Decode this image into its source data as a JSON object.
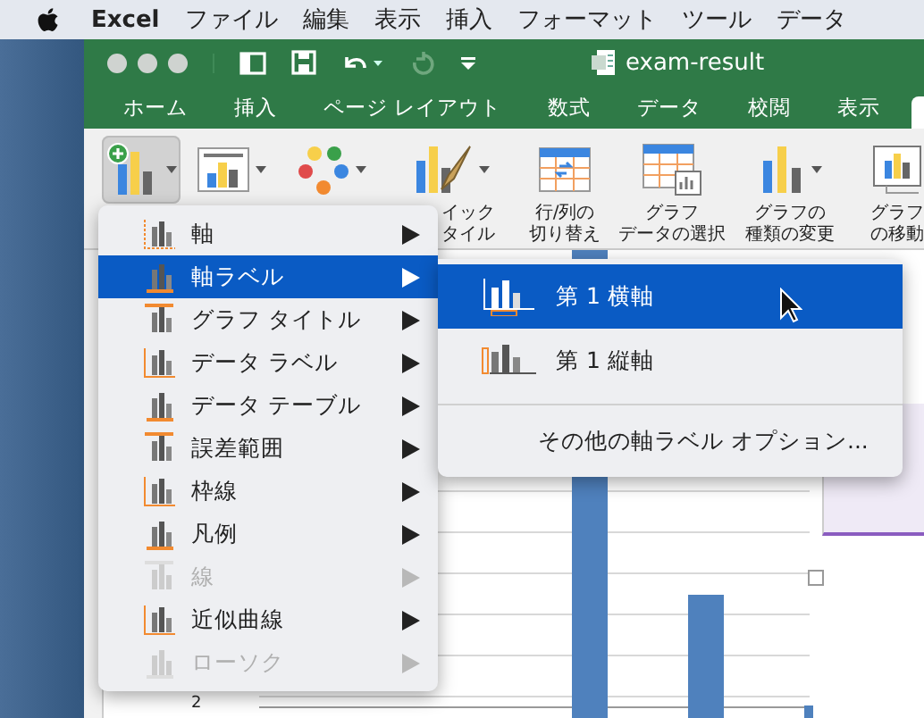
{
  "menubar": {
    "app": "Excel",
    "items": [
      "ファイル",
      "編集",
      "表示",
      "挿入",
      "フォーマット",
      "ツール",
      "データ"
    ]
  },
  "window": {
    "title": "exam-result"
  },
  "tabs": [
    {
      "label": "ホーム"
    },
    {
      "label": "挿入"
    },
    {
      "label": "ページ レイアウト"
    },
    {
      "label": "数式"
    },
    {
      "label": "データ"
    },
    {
      "label": "校閲"
    },
    {
      "label": "表示"
    }
  ],
  "ribbon": {
    "buttons": [
      {
        "kind": "add-element",
        "pressed": true,
        "dropdown": true
      },
      {
        "kind": "quick-layout",
        "pressed": false,
        "dropdown": true
      },
      {
        "kind": "colors",
        "pressed": false,
        "dropdown": true
      },
      {
        "kind": "styles",
        "pressed": false,
        "dropdown": true,
        "lines": [
          "イック",
          "タイル"
        ]
      },
      {
        "kind": "switch",
        "pressed": false,
        "dropdown": false,
        "lines": [
          "行/列の",
          "切り替え"
        ]
      },
      {
        "kind": "select-data",
        "pressed": false,
        "dropdown": false,
        "lines": [
          "グラフ",
          "データの選択"
        ]
      },
      {
        "kind": "change-type",
        "pressed": false,
        "dropdown": true,
        "lines": [
          "グラフの",
          "種類の変更"
        ]
      },
      {
        "kind": "move",
        "pressed": false,
        "dropdown": false,
        "lines": [
          "グラフ",
          "の移動"
        ]
      }
    ]
  },
  "chart_menu": {
    "items": [
      {
        "label": "軸",
        "selected": false,
        "disabled": false
      },
      {
        "label": "軸ラベル",
        "selected": true,
        "disabled": false
      },
      {
        "label": "グラフ タイトル",
        "selected": false,
        "disabled": false
      },
      {
        "label": "データ ラベル",
        "selected": false,
        "disabled": false
      },
      {
        "label": "データ テーブル",
        "selected": false,
        "disabled": false
      },
      {
        "label": "誤差範囲",
        "selected": false,
        "disabled": false
      },
      {
        "label": "枠線",
        "selected": false,
        "disabled": false
      },
      {
        "label": "凡例",
        "selected": false,
        "disabled": false
      },
      {
        "label": "線",
        "selected": false,
        "disabled": true
      },
      {
        "label": "近似曲線",
        "selected": false,
        "disabled": false
      },
      {
        "label": "ローソク",
        "selected": false,
        "disabled": true
      }
    ]
  },
  "submenu": {
    "items": [
      {
        "label": "第 1 横軸",
        "selected": true
      },
      {
        "label": "第 1 縦軸",
        "selected": false
      }
    ],
    "more_option": "その他の軸ラベル オプション..."
  },
  "chart": {
    "axis_tick": "2"
  }
}
